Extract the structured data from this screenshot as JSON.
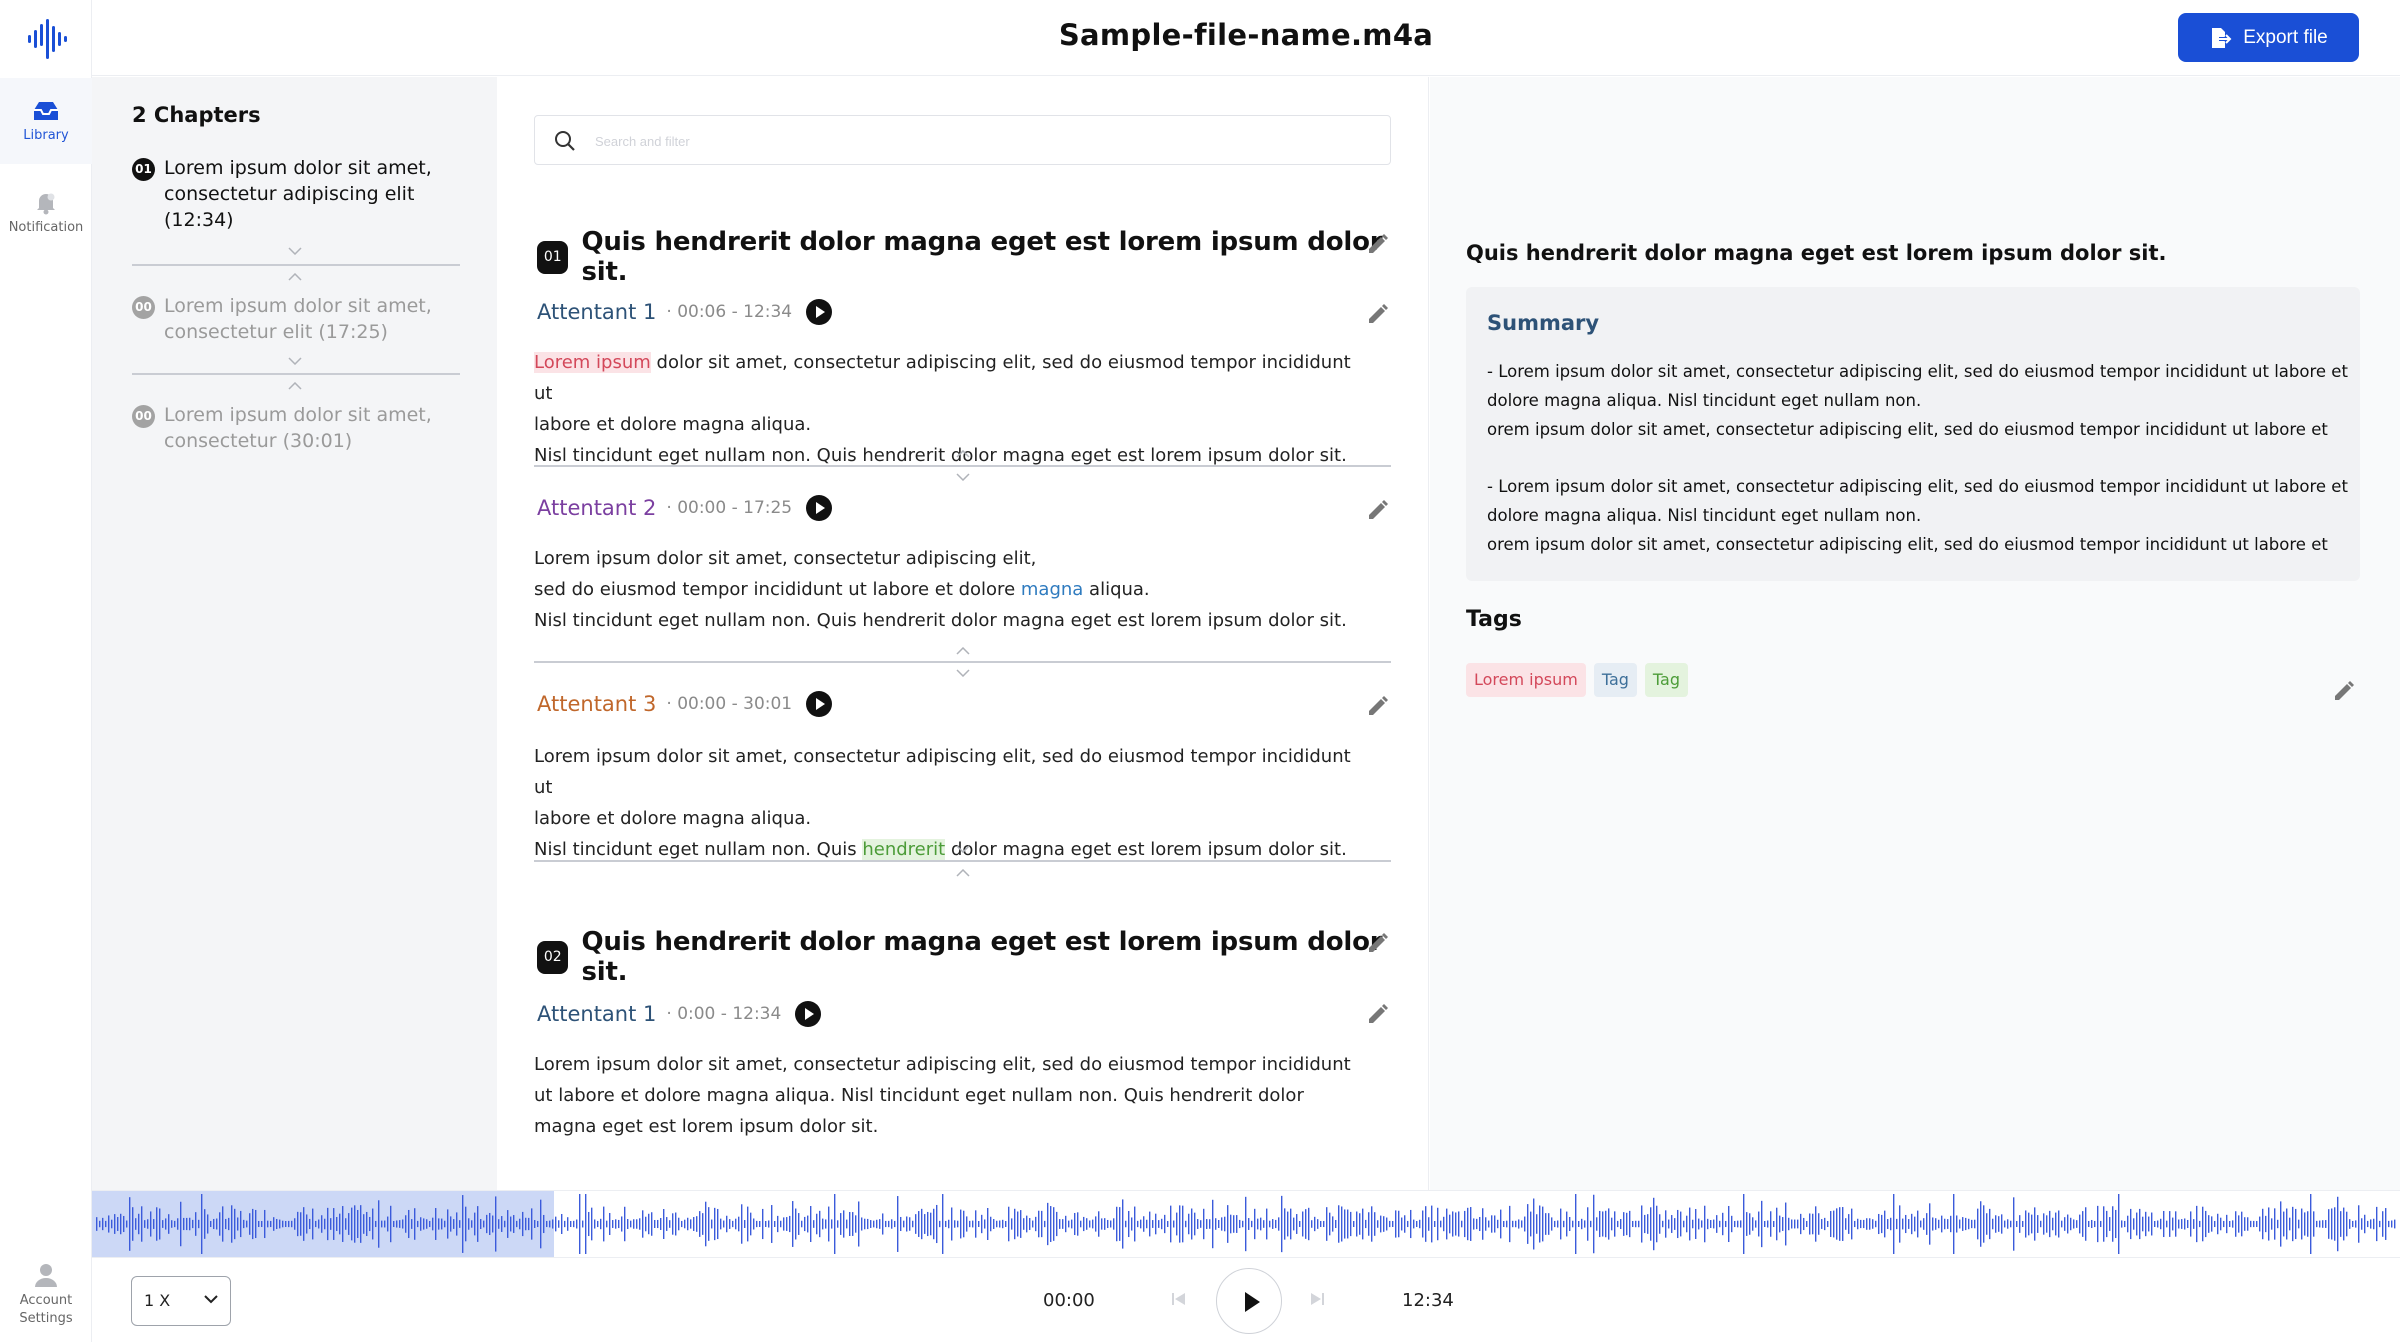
{
  "header": {
    "file_name": "Sample-file-name.m4a",
    "export_label": "Export file"
  },
  "nav": {
    "library": "Library",
    "notification": "Notification",
    "account_line1": "Account",
    "account_line2": "Settings"
  },
  "chapters": {
    "heading": "2 Chapters",
    "items": [
      {
        "num": "01",
        "text": "Lorem ipsum dolor sit amet, consectetur adipiscing elit (12:34)"
      },
      {
        "num": "00",
        "text": "Lorem ipsum dolor sit amet, consectetur elit (17:25)"
      },
      {
        "num": "00",
        "text": "Lorem ipsum dolor sit amet, consectetur (30:01)"
      }
    ]
  },
  "search": {
    "placeholder": "Search and filter"
  },
  "sections": [
    {
      "num": "01",
      "title": "Quis hendrerit dolor magna eget est lorem ipsum dolor sit.",
      "blocks": [
        {
          "speaker": "Attentant 1",
          "time": "· 00:06 - 12:34",
          "color": "#2d5277",
          "lines": [
            {
              "hl": "Lorem ipsum",
              "rest": " dolor sit amet, consectetur adipiscing elit, sed do eiusmod tempor incididunt ut"
            },
            {
              "text": "labore et dolore magna aliqua."
            },
            {
              "text": "Nisl tincidunt eget nullam non. Quis hendrerit dolor magna eget est lorem ipsum dolor sit."
            }
          ]
        },
        {
          "speaker": "Attentant 2",
          "time": "· 00:00 - 17:25",
          "color": "#7b3fa0",
          "lines": [
            {
              "text": "Lorem ipsum dolor sit amet, consectetur adipiscing elit,"
            },
            {
              "pre": "sed do eiusmod tempor incididunt ut labore et dolore ",
              "hl": "magna",
              "rest": " aliqua."
            },
            {
              "text": "Nisl tincidunt eget nullam non. Quis hendrerit dolor magna eget est lorem ipsum dolor sit."
            }
          ]
        },
        {
          "speaker": "Attentant 3",
          "time": "· 00:00 - 30:01",
          "color": "#c0672b",
          "lines": [
            {
              "text": "Lorem ipsum dolor sit amet, consectetur adipiscing elit, sed do eiusmod tempor incididunt ut"
            },
            {
              "text": "labore et dolore magna aliqua."
            },
            {
              "pre": "Nisl tincidunt eget nullam non. Quis ",
              "hl": "hendrerit",
              "rest": " dolor magna eget est lorem ipsum dolor sit."
            }
          ]
        }
      ]
    },
    {
      "num": "02",
      "title": "Quis hendrerit dolor magna eget est lorem ipsum dolor sit.",
      "blocks": [
        {
          "speaker": "Attentant 1",
          "time": "· 0:00 - 12:34",
          "color": "#2d5277",
          "lines": [
            {
              "text": "Lorem ipsum dolor sit amet, consectetur adipiscing elit, sed do eiusmod tempor incididunt"
            },
            {
              "text": "ut labore et dolore magna aliqua. Nisl tincidunt eget nullam non. Quis hendrerit dolor"
            },
            {
              "text": "magna eget est lorem ipsum dolor sit."
            }
          ]
        }
      ]
    }
  ],
  "summary": {
    "question": "Quis hendrerit dolor magna eget est lorem ipsum dolor sit.",
    "label": "Summary",
    "para1": [
      "- Lorem ipsum dolor sit amet, consectetur adipiscing elit, sed do eiusmod tempor incididunt ut labore et",
      "dolore magna aliqua. Nisl tincidunt eget nullam non.",
      "orem ipsum dolor sit amet, consectetur adipiscing elit, sed do eiusmod tempor incididunt ut labore et"
    ],
    "para2": [
      "- Lorem ipsum dolor sit amet, consectetur adipiscing elit, sed do eiusmod tempor incididunt ut labore et",
      "dolore magna aliqua. Nisl tincidunt eget nullam non.",
      "orem ipsum dolor sit amet, consectetur adipiscing elit, sed do eiusmod tempor incididunt ut labore et"
    ]
  },
  "tags": {
    "label": "Tags",
    "items": [
      "Lorem ipsum",
      "Tag",
      "Tag"
    ]
  },
  "player": {
    "speed": "1 X",
    "current_time": "00:00",
    "total_time": "12:34",
    "played_fraction": 0.2
  },
  "colors": {
    "accent": "#1a4fd6",
    "waveform": "#3b5bdb",
    "waveform_played_bg": "#ccd8f6"
  }
}
